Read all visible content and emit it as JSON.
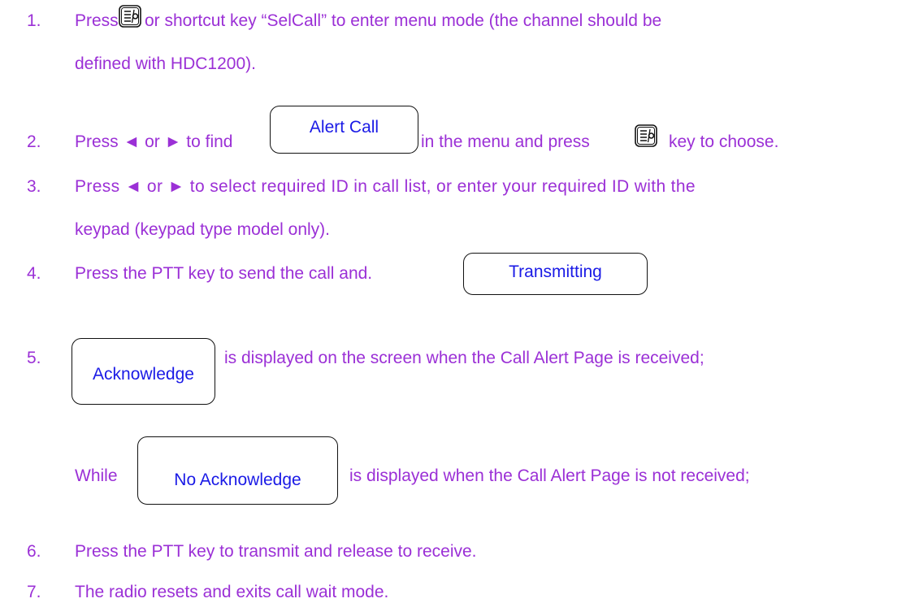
{
  "steps": [
    {
      "num": "1.",
      "line1_a": "Press",
      "line1_b": " or shortcut key “SelCall” to enter menu mode (the channel should be",
      "line2": "defined with HDC1200)."
    },
    {
      "num": "2.",
      "text_a": "Press ◄ or ► to find",
      "screen": "Alert Call",
      "text_b": "in the menu and press",
      "text_c": "key to choose."
    },
    {
      "num": "3.",
      "line1": "Press ◄ or ► to select required ID in call list, or enter your required ID with the",
      "line2": "keypad (keypad type model only)."
    },
    {
      "num": "4.",
      "text_a": "Press the PTT key to send the call and.",
      "screen": "Transmitting"
    },
    {
      "num": "5.",
      "screen_a": "Acknowledge",
      "text_a": "is displayed on the screen when the Call Alert Page is received;",
      "text_b": "While",
      "screen_b": "No Acknowledge",
      "text_c": "is displayed when the Call Alert Page is not received;"
    },
    {
      "num": "6.",
      "line1": "Press the PTT key to transmit and release to receive."
    },
    {
      "num": "7.",
      "line1": "The radio resets and exits call wait mode."
    }
  ],
  "colors": {
    "body_text": "#9b30d6",
    "screen_text": "#1a1ae6",
    "border": "#111111"
  },
  "icons": {
    "menu_key": "menu-key-icon"
  }
}
